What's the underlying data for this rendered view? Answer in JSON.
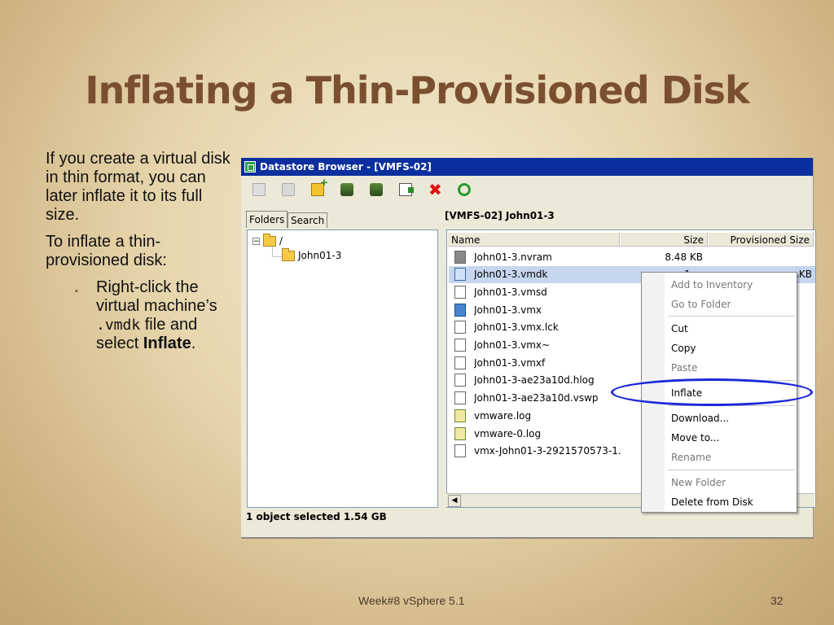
{
  "slide": {
    "title": "Inflating a Thin-Provisioned Disk",
    "para1": "If you create a virtual disk in thin format, you can later inflate it to its full size.",
    "para2": "To inflate a thin-provisioned disk:",
    "bullet_marker": "▪",
    "bullet": {
      "part1": "Right-click the virtual machine’s",
      "code": ".vmdk",
      "part2": " file and select ",
      "bold": "Inflate",
      "end": "."
    },
    "footer": "Week#8 vSphere 5.1",
    "page_number": "32"
  },
  "window": {
    "title": "Datastore Browser - [VMFS-02]",
    "toolbar_icons": [
      "properties-icon",
      "browse-datastore-icon",
      "new-folder-icon",
      "upload-icon",
      "download-icon",
      "move-icon",
      "delete-icon",
      "refresh-icon"
    ],
    "tabs": [
      "Folders",
      "Search"
    ],
    "tree": [
      {
        "label": "/"
      },
      {
        "label": "John01-3"
      }
    ],
    "path": "[VMFS-02] John01-3",
    "columns": [
      "Name",
      "Size",
      "Provisioned Size"
    ],
    "files": [
      {
        "name": "John01-3.nvram",
        "size": "8.48 KB",
        "prov": "",
        "type": "nvram"
      },
      {
        "name": "John01-3.vmdk",
        "size": "1,...",
        "prov": "...KB",
        "type": "vmdk"
      },
      {
        "name": "John01-3.vmsd",
        "size": "",
        "prov": "",
        "type": "file"
      },
      {
        "name": "John01-3.vmx",
        "size": "",
        "prov": "",
        "type": "vmx"
      },
      {
        "name": "John01-3.vmx.lck",
        "size": "",
        "prov": "",
        "type": "file"
      },
      {
        "name": "John01-3.vmx~",
        "size": "",
        "prov": "",
        "type": "file"
      },
      {
        "name": "John01-3.vmxf",
        "size": "",
        "prov": "",
        "type": "file"
      },
      {
        "name": "John01-3-ae23a10d.hlog",
        "size": "",
        "prov": "",
        "type": "file"
      },
      {
        "name": "John01-3-ae23a10d.vswp",
        "size": "",
        "prov": "",
        "type": "file"
      },
      {
        "name": "vmware.log",
        "size": "",
        "prov": "",
        "type": "log"
      },
      {
        "name": "vmware-0.log",
        "size": "",
        "prov": "",
        "type": "log"
      },
      {
        "name": "vmx-John01-3-2921570573-1....",
        "size": "",
        "prov": "",
        "type": "file"
      }
    ],
    "status": "1 object selected 1.54 GB"
  },
  "context_menu": {
    "items": [
      {
        "label": "Add to Inventory",
        "disabled": true
      },
      {
        "label": "Go to Folder",
        "disabled": true
      },
      {
        "label": "Cut",
        "disabled": false
      },
      {
        "label": "Copy",
        "disabled": false
      },
      {
        "label": "Paste",
        "disabled": true
      },
      {
        "label": "Inflate",
        "disabled": false
      },
      {
        "label": "Download...",
        "disabled": false
      },
      {
        "label": "Move to...",
        "disabled": false
      },
      {
        "label": "Rename",
        "disabled": true
      },
      {
        "label": "New Folder",
        "disabled": true
      },
      {
        "label": "Delete from Disk",
        "disabled": false
      }
    ]
  },
  "colors": {
    "titlebar": "#0b2f9e",
    "slide_title": "#7a4f2f",
    "highlight_oval": "#1a2ad8",
    "selected_row": "#c6d6ee"
  }
}
